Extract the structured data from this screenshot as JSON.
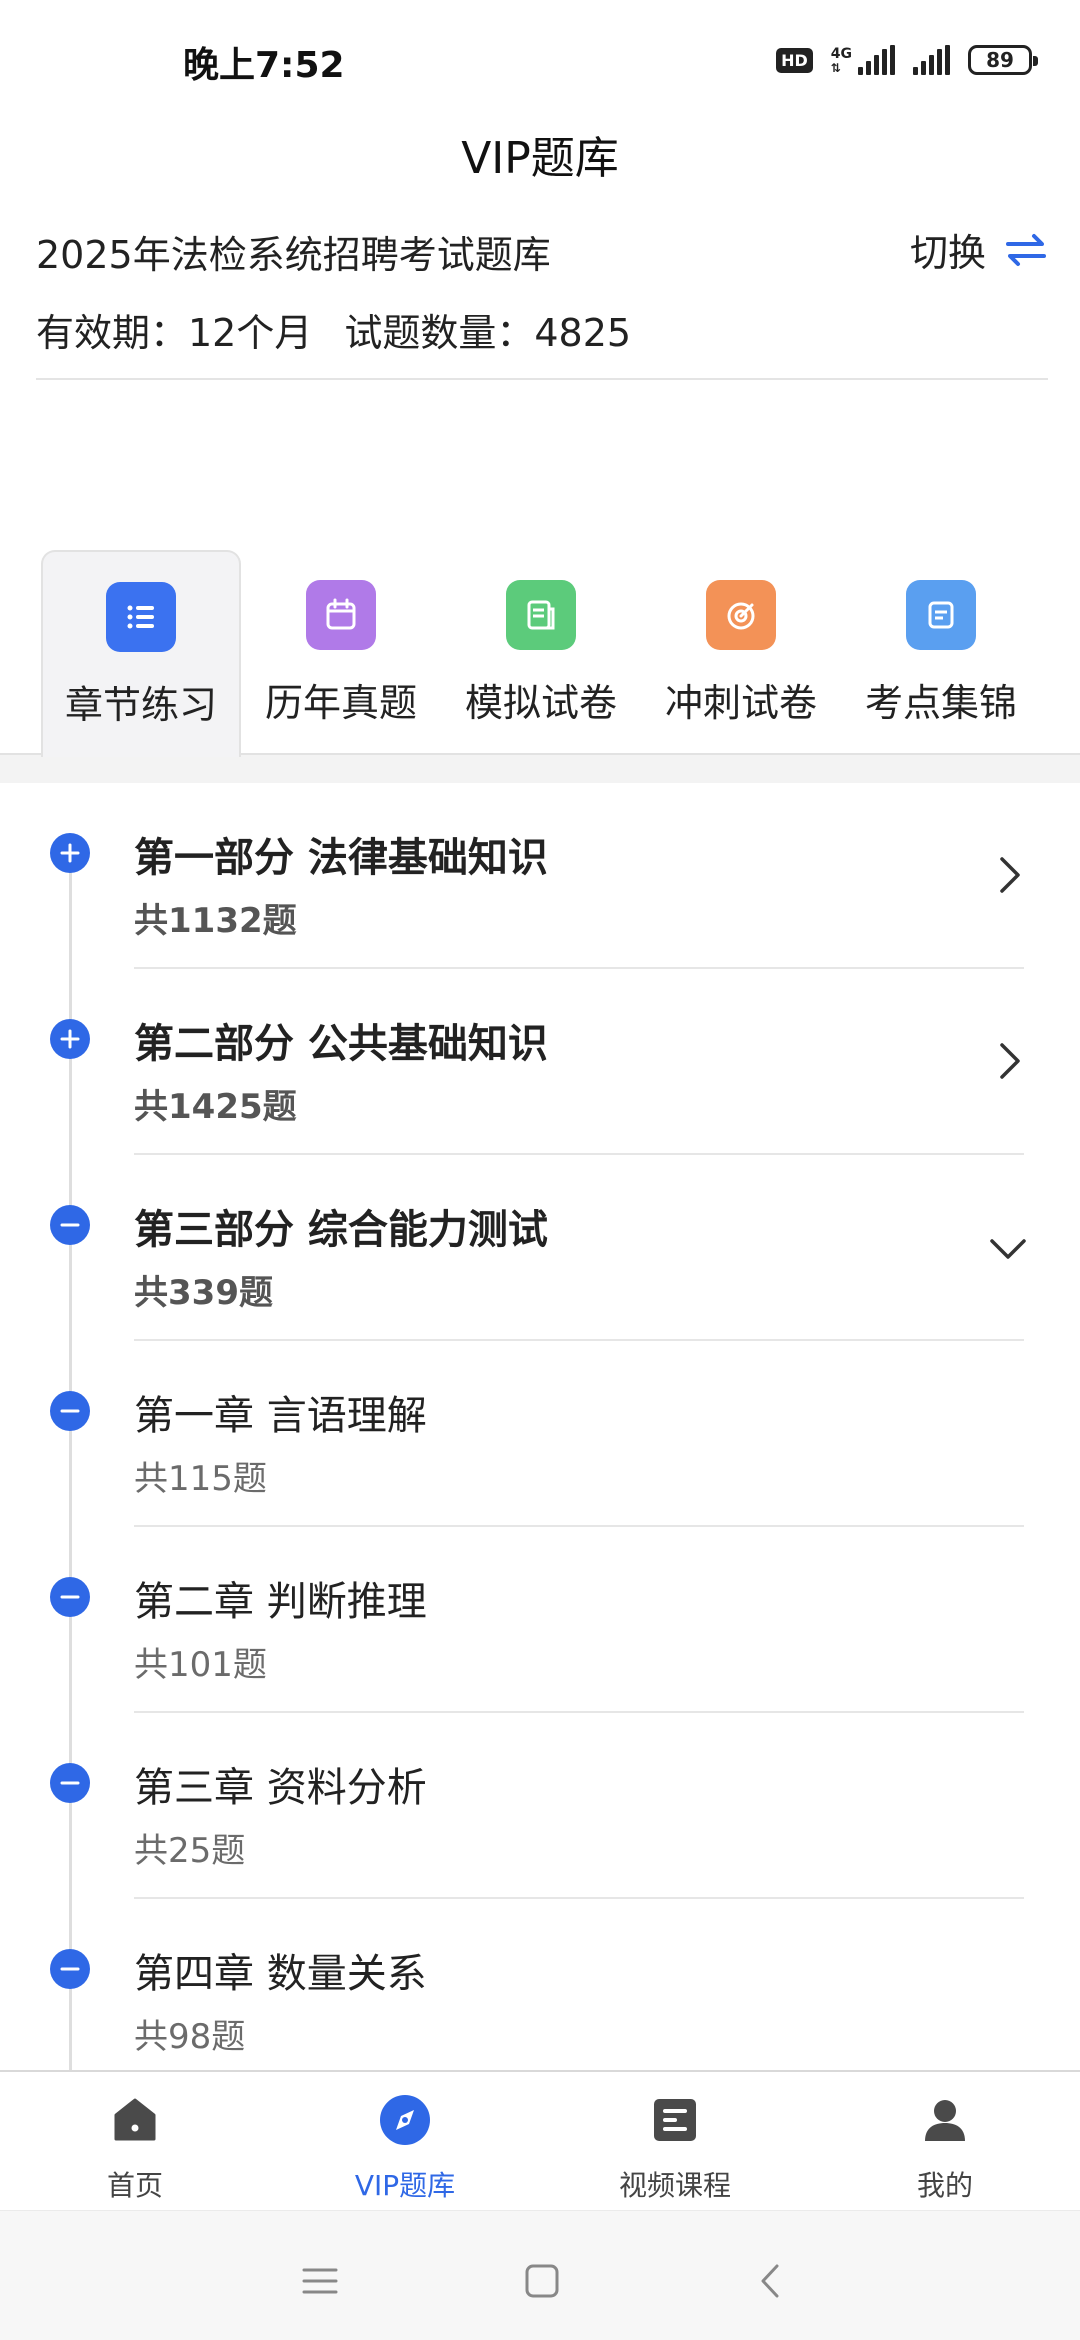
{
  "status_bar": {
    "time": "晚上7:52",
    "hd": "HD",
    "network_type": "4G",
    "battery": "89"
  },
  "header": {
    "title": "VIP题库",
    "bank_name": "2025年法检系统招聘考试题库",
    "switch_label": "切换",
    "validity": "有效期：12个月",
    "question_count": "试题数量：4825"
  },
  "tabs": [
    {
      "label": "章节练习",
      "icon": "list-icon",
      "color": "#3b72f0",
      "active": true
    },
    {
      "label": "历年真题",
      "icon": "calendar-icon",
      "color": "#b07ae8"
    },
    {
      "label": "模拟试卷",
      "icon": "paper-icon",
      "color": "#5ccb7b"
    },
    {
      "label": "冲刺试卷",
      "icon": "target-icon",
      "color": "#f39257"
    },
    {
      "label": "考点集锦",
      "icon": "collection-icon",
      "color": "#5a9ff0"
    }
  ],
  "chapters": [
    {
      "title": "第一部分 法律基础知识",
      "count": "共1132题",
      "state": "collapsed",
      "level": "part"
    },
    {
      "title": "第二部分 公共基础知识",
      "count": "共1425题",
      "state": "collapsed",
      "level": "part"
    },
    {
      "title": "第三部分 综合能力测试",
      "count": "共339题",
      "state": "expanded",
      "level": "part"
    },
    {
      "title": "第一章 言语理解",
      "count": "共115题",
      "level": "chapter"
    },
    {
      "title": "第二章 判断推理",
      "count": "共101题",
      "level": "chapter"
    },
    {
      "title": "第三章 资料分析",
      "count": "共25题",
      "level": "chapter"
    },
    {
      "title": "第四章 数量关系",
      "count": "共98题",
      "level": "chapter"
    }
  ],
  "bottom_nav": [
    {
      "label": "首页",
      "icon": "home-icon"
    },
    {
      "label": "VIP题库",
      "icon": "compass-icon",
      "active": true
    },
    {
      "label": "视频课程",
      "icon": "document-icon"
    },
    {
      "label": "我的",
      "icon": "user-icon"
    }
  ],
  "colors": {
    "accent": "#2f68e6",
    "text": "#222222",
    "muted": "#6b6b6b"
  }
}
